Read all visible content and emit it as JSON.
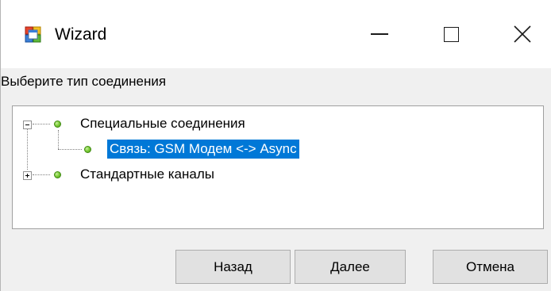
{
  "window": {
    "title": "Wizard",
    "icon": "app-window-icon",
    "controls": {
      "minimize": "minimize-icon",
      "maximize": "maximize-icon",
      "close": "close-icon"
    }
  },
  "prompt": "Выберите тип соединения",
  "tree": {
    "nodes": [
      {
        "label": "Специальные соединения",
        "expanded": true,
        "level": 0
      },
      {
        "label": "Связь: GSM Модем <-> Async",
        "selected": true,
        "level": 1
      },
      {
        "label": "Стандартные каналы",
        "expanded": false,
        "level": 0
      }
    ],
    "bullet_color": "#7fce3a",
    "selection_color": "#0078d7"
  },
  "buttons": {
    "back": "Назад",
    "next": "Далее",
    "cancel": "Отмена"
  }
}
